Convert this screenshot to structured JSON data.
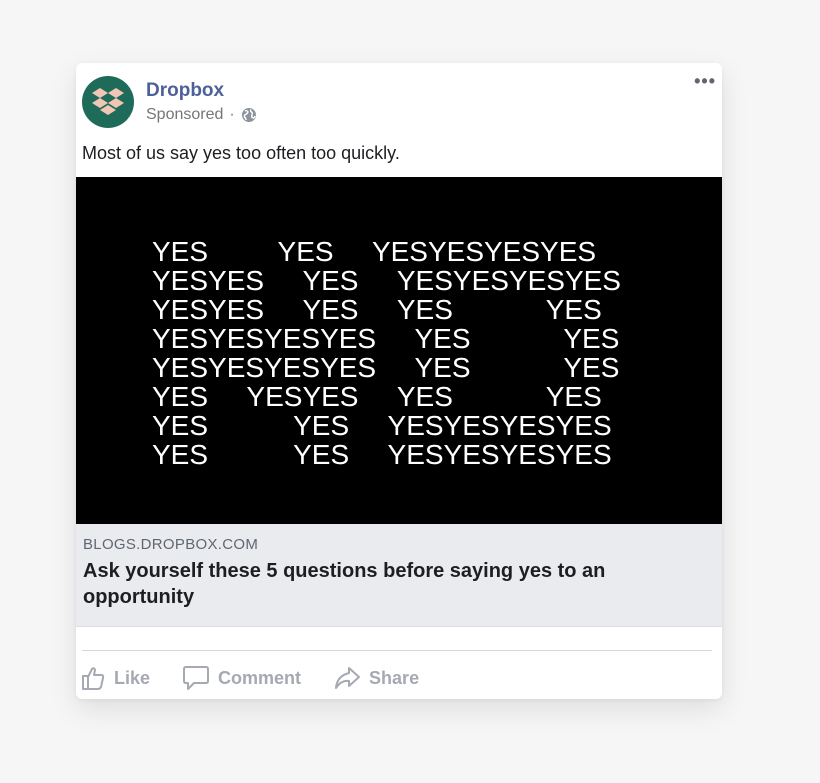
{
  "post": {
    "page_name": "Dropbox",
    "sponsored_label": "Sponsored",
    "separator": "·",
    "audience_icon": "globe-icon",
    "more_label": "•••",
    "caption": "Most of us say yes too often too quickly."
  },
  "image": {
    "lines": [
      "YES         YES     YESYESYESYES",
      "YESYES     YES     YESYESYESYES",
      "YESYES     YES     YES            YES",
      "YESYESYESYES     YES            YES",
      "YESYESYESYES     YES            YES",
      "YES     YESYES     YES            YES",
      "YES           YES     YESYESYESYES",
      "YES           YES     YESYESYESYES"
    ]
  },
  "link": {
    "domain": "BLOGS.DROPBOX.COM",
    "headline": "Ask yourself these 5 questions before saying yes to an opportunity"
  },
  "actions": {
    "like": "Like",
    "comment": "Comment",
    "share": "Share"
  },
  "colors": {
    "brand_avatar": "#1f6b5a",
    "logo": "#f2c6b4",
    "page_name": "#4d6199"
  }
}
